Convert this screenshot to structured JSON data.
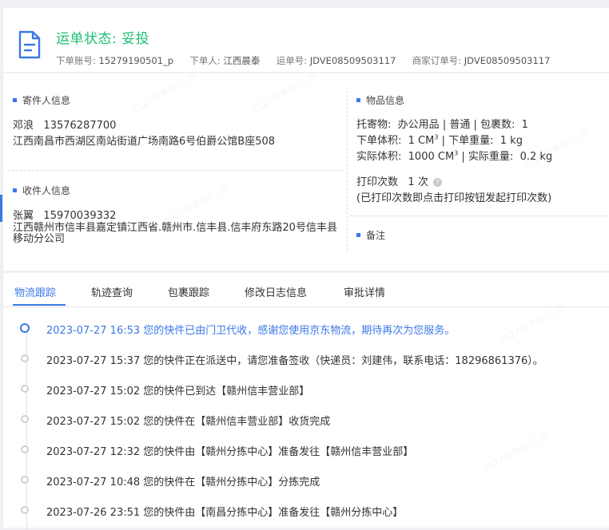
{
  "header": {
    "status_label": "运单状态: 妥投",
    "order_no_label": "下单账号:",
    "order_no": "15279190501_p",
    "orderer_label": "下单人:",
    "orderer": "江西晨泰",
    "waybill_label": "运单号:",
    "waybill": "JDVE08509503117",
    "merchant_label": "商家订单号:",
    "merchant_order": "JDVE08509503117"
  },
  "sender": {
    "heading": "寄件人信息",
    "name": "邓浪",
    "phone": "13576287700",
    "address": "江西南昌市西湖区南站街道广场南路6号伯爵公馆B座508"
  },
  "receiver": {
    "heading": "收件人信息",
    "name": "张翼",
    "phone": "15970039332",
    "address": "江西赣州市信丰县嘉定镇江西省.赣州市.信丰县.信丰府东路20号信丰县移动分公司"
  },
  "goods": {
    "heading": "物品信息",
    "line1_label": "托寄物:",
    "category": "办公用品",
    "service": "普通",
    "package_label": "包裹数:",
    "package_count": "1",
    "order_volume_label": "下单体积:",
    "order_volume": "1 CM",
    "order_weight_label": "下单重量:",
    "order_weight": "1 kg",
    "actual_volume_label": "实际体积:",
    "actual_volume": "1000 CM",
    "actual_weight_label": "实际重量:",
    "actual_weight": "0.2 kg",
    "volume_sup": "3",
    "print_label": "打印次数",
    "print_count": "1 次",
    "print_note": "(已打印次数即点击打印按钮发起打印次数)",
    "help_glyph": "?"
  },
  "remarks": {
    "heading": "备注"
  },
  "tabs": [
    {
      "label": "物流跟踪"
    },
    {
      "label": "轨迹查询"
    },
    {
      "label": "包裹跟踪"
    },
    {
      "label": "修改日志信息"
    },
    {
      "label": "审批详情"
    }
  ],
  "timeline": [
    {
      "text": "2023-07-27 16:53 您的快件已由门卫代收，感谢您使用京东物流，期待再次为您服务。"
    },
    {
      "text": "2023-07-27 15:37 您的快件正在派送中，请您准备签收（快递员：刘建伟，联系电话：18296861376）。"
    },
    {
      "text": "2023-07-27 15:02 您的快件已到达【赣州信丰营业部】"
    },
    {
      "text": "2023-07-27 15:02 您的快件在【赣州信丰营业部】收货完成"
    },
    {
      "text": "2023-07-27 12:32 您的快件由【赣州分拣中心】准备发往【赣州信丰营业部】"
    },
    {
      "text": "2023-07-27 10:48 您的快件在【赣州分拣中心】分拣完成"
    },
    {
      "text": "2023-07-26 23:51 您的快件由【南昌分拣中心】准备发往【赣州分拣中心】"
    }
  ],
  "watermark": "15279190501_p",
  "colors": {
    "accent": "#3b78e7",
    "status_green": "#1bbf73"
  }
}
